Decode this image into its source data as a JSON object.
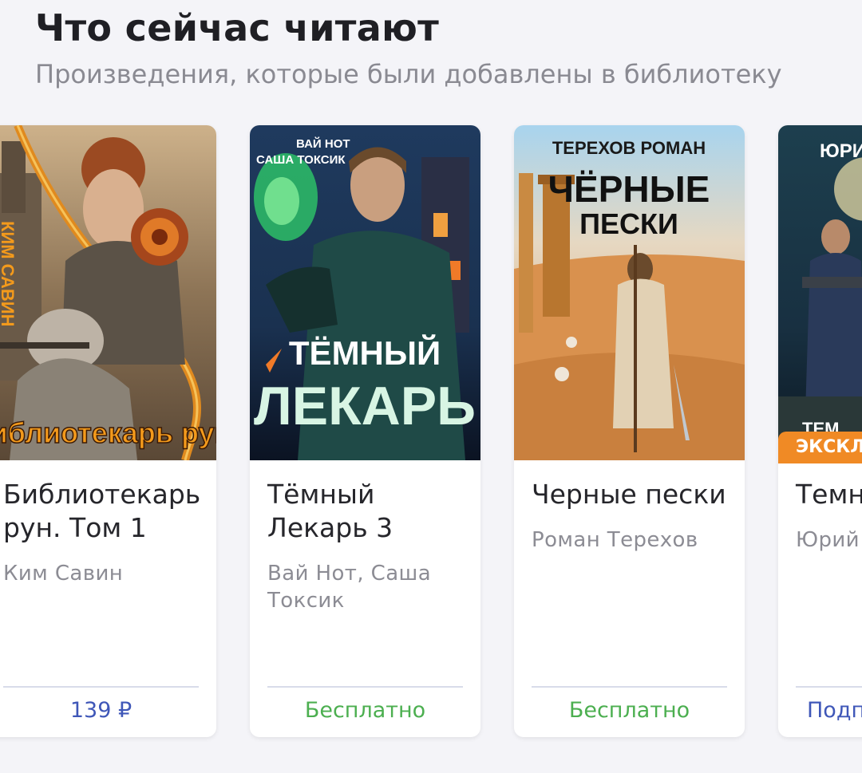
{
  "section": {
    "title": "Что сейчас читают",
    "subtitle": "Произведения, которые были добавлены в библиотеку"
  },
  "colors": {
    "paid_price": "#3f57b8",
    "free_price": "#4caf50",
    "badge": "#f08a25"
  },
  "books": [
    {
      "cover_text": "Библиотекарь рун",
      "cover_author_text": "КИМ САВИН",
      "title": "Библиотекарь рун. Том 1",
      "author": "Ким Савин",
      "price": "139 ₽"
    },
    {
      "cover_author_line1": "ВАЙ НОТ",
      "cover_author_line2": "САША ТОКСИК",
      "cover_title_line1": "ТЁМНЫЙ",
      "cover_title_line2": "ЛЕКАРЬ",
      "title": "Тёмный Лекарь 3",
      "author": "Вай Нот, Саша Токсик",
      "price": "Бесплатно"
    },
    {
      "cover_author": "ТЕРЕХОВ РОМАН",
      "cover_title_line1": "ЧЁРНЫЕ",
      "cover_title_line2": "ПЕСКИ",
      "title": "Черные пески",
      "author": "Роман Терехов",
      "price": "Бесплатно"
    },
    {
      "cover_author": "ЮРИ",
      "cover_title": "ТЕМ",
      "badge": "ЭКСКЛЮ",
      "title": "Темн",
      "author": "Юрий",
      "price": "Подп"
    }
  ]
}
